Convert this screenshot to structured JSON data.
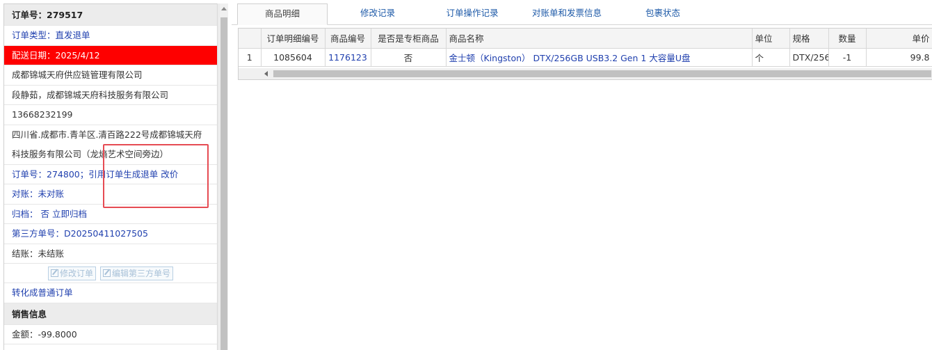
{
  "order": {
    "header": "订单号：279517",
    "type": "订单类型：直发退单",
    "delivery_date": "配送日期：2025/4/12",
    "supplier": "成都锦城天府供应链管理有限公司",
    "contact": "段静茹，成都锦城天府科技服务有限公司",
    "phone": "13668232199",
    "address_line1": "四川省.成都市.青羊区.清百路222号成都锦城天府",
    "address_line2": "科技服务有限公司（龙熵艺术空间旁边）",
    "ref_order_prefix": "订单号：",
    "ref_order_no": "274800",
    "ref_order_sep": "；",
    "ref_links": "引用订单生成退单 改价",
    "reconcile": "对账：未对账",
    "archive_prefix": "归档：",
    "archive_value": "否",
    "archive_link": "立即归档",
    "third_party": "第三方单号：D20250411027505",
    "settlement": "结账：未结账",
    "edit_order_btn": "修改订单",
    "edit_third_btn": "编辑第三方单号",
    "convert_link": "转化成普通订单",
    "sales_header": "销售信息",
    "amount": "金额：-99.8000"
  },
  "tabs": [
    "商品明细",
    "修改记录",
    "订单操作记录",
    "对账单和发票信息",
    "包裹状态"
  ],
  "active_tab": "商品明细",
  "grid": {
    "columns": [
      "",
      "订单明细编号",
      "商品编号",
      "是否是专柜商品",
      "商品名称",
      "单位",
      "规格",
      "数量",
      "单价"
    ],
    "rows": [
      {
        "index": "1",
        "detail_no": "1085604",
        "product_no": "1176123",
        "counter": "否",
        "name": "金士顿（Kingston） DTX/256GB USB3.2 Gen 1 大容量U盘",
        "unit": "个",
        "spec": "DTX/256",
        "qty": "-1",
        "price": "99.8"
      }
    ]
  },
  "colors": {
    "link_blue": "#1f3fae",
    "highlight_red": "#fe0000",
    "annotation_red": "#e64b53",
    "tab_blue": "#1e5aa8"
  },
  "icons": [
    "edit-icon",
    "scroll-up-arrow-icon",
    "scroll-left-arrow-icon"
  ]
}
